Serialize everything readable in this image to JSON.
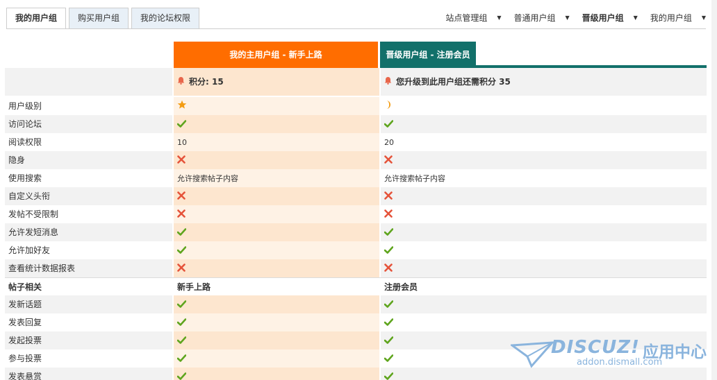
{
  "tabs": [
    {
      "label": "我的用户组"
    },
    {
      "label": "购买用户组"
    },
    {
      "label": "我的论坛权限"
    }
  ],
  "group_nav": [
    {
      "label": "站点管理组"
    },
    {
      "label": "普通用户组"
    },
    {
      "label": "晋级用户组"
    },
    {
      "label": "我的用户组"
    }
  ],
  "columns": {
    "main": "我的主用户组 - 新手上路",
    "next": "晋级用户组 - 注册会员"
  },
  "points": {
    "main": "积分: 15",
    "next": "您升级到此用户组还需积分 35"
  },
  "rows": [
    {
      "label": "用户级别",
      "main": "star-icon",
      "next": "moon-icon"
    },
    {
      "label": "访问论坛",
      "main": "check-icon",
      "next": "check-icon"
    },
    {
      "label": "阅读权限",
      "main": "10",
      "next": "20"
    },
    {
      "label": "隐身",
      "main": "cross-icon",
      "next": "cross-icon"
    },
    {
      "label": "使用搜索",
      "main": "允许搜索帖子内容",
      "next": "允许搜索帖子内容"
    },
    {
      "label": "自定义头衔",
      "main": "cross-icon",
      "next": "cross-icon"
    },
    {
      "label": "发帖不受限制",
      "main": "cross-icon",
      "next": "cross-icon"
    },
    {
      "label": "允许发短消息",
      "main": "check-icon",
      "next": "check-icon"
    },
    {
      "label": "允许加好友",
      "main": "check-icon",
      "next": "check-icon"
    },
    {
      "label": "查看统计数据报表",
      "main": "cross-icon",
      "next": "cross-icon"
    }
  ],
  "section": {
    "label": "帖子相关",
    "main": "新手上路",
    "next": "注册会员"
  },
  "section_rows": [
    {
      "label": "发新话题",
      "main": "check-icon",
      "next": "check-icon"
    },
    {
      "label": "发表回复",
      "main": "check-icon",
      "next": "check-icon"
    },
    {
      "label": "发起投票",
      "main": "check-icon",
      "next": "check-icon"
    },
    {
      "label": "参与投票",
      "main": "check-icon",
      "next": "check-icon"
    },
    {
      "label": "发表悬赏",
      "main": "check-icon",
      "next": "check-icon"
    }
  ],
  "watermark": {
    "logo": "DISCUZ!",
    "cn": "应用中心",
    "url": "addon.dismall.com"
  },
  "colors": {
    "main_header": "#ff6d00",
    "next_header": "#12706a",
    "check": "#5fa51e",
    "cross": "#e5533a",
    "star": "#f39c12",
    "bell": "#e8664b"
  }
}
